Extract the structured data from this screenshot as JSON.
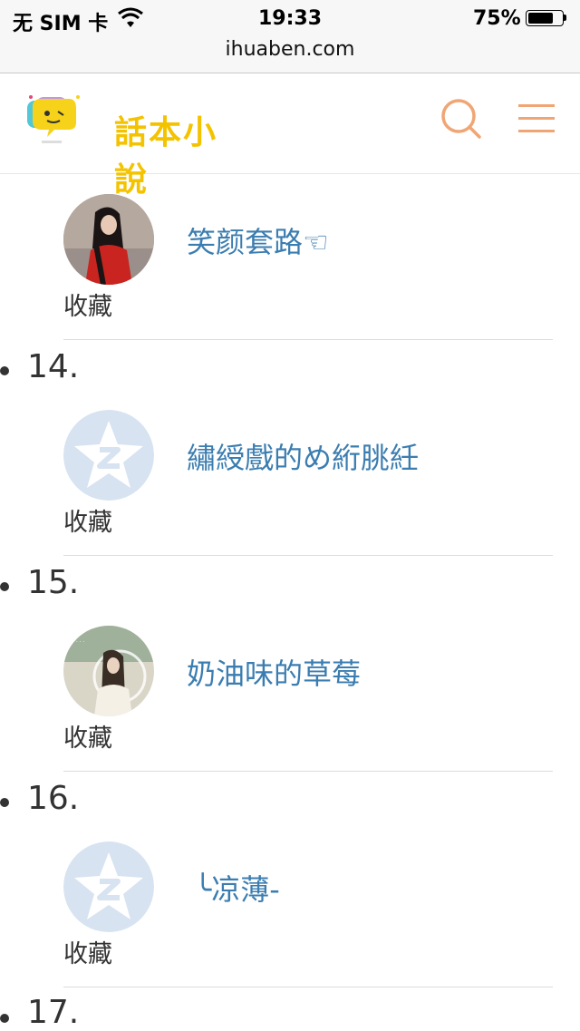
{
  "status": {
    "carrier": "无 SIM 卡",
    "time": "19:33",
    "battery": "75%",
    "battery_level": 0.75
  },
  "url": "ihuaben.com",
  "header": {
    "logo_text": "話本小說",
    "search_icon": "search-icon",
    "menu_icon": "menu-icon"
  },
  "list": {
    "entry13": {
      "name": "笑颜套路☜",
      "fav": "收藏",
      "avatar": "photo-avatar"
    },
    "num14": "14.",
    "entry14": {
      "name": "繡綬戲的め絎朓紝",
      "fav": "收藏",
      "avatar": "default-avatar"
    },
    "num15": "15.",
    "entry15": {
      "name": "奶油味的草莓",
      "fav": "收藏",
      "avatar": "photo-avatar"
    },
    "num16": "16.",
    "entry16": {
      "name": "╰凉薄-",
      "fav": "收藏",
      "avatar": "default-avatar"
    },
    "num17": "17."
  },
  "colors": {
    "link": "#3b7db0",
    "accent": "#f0a674",
    "logo": "#f4c300"
  }
}
